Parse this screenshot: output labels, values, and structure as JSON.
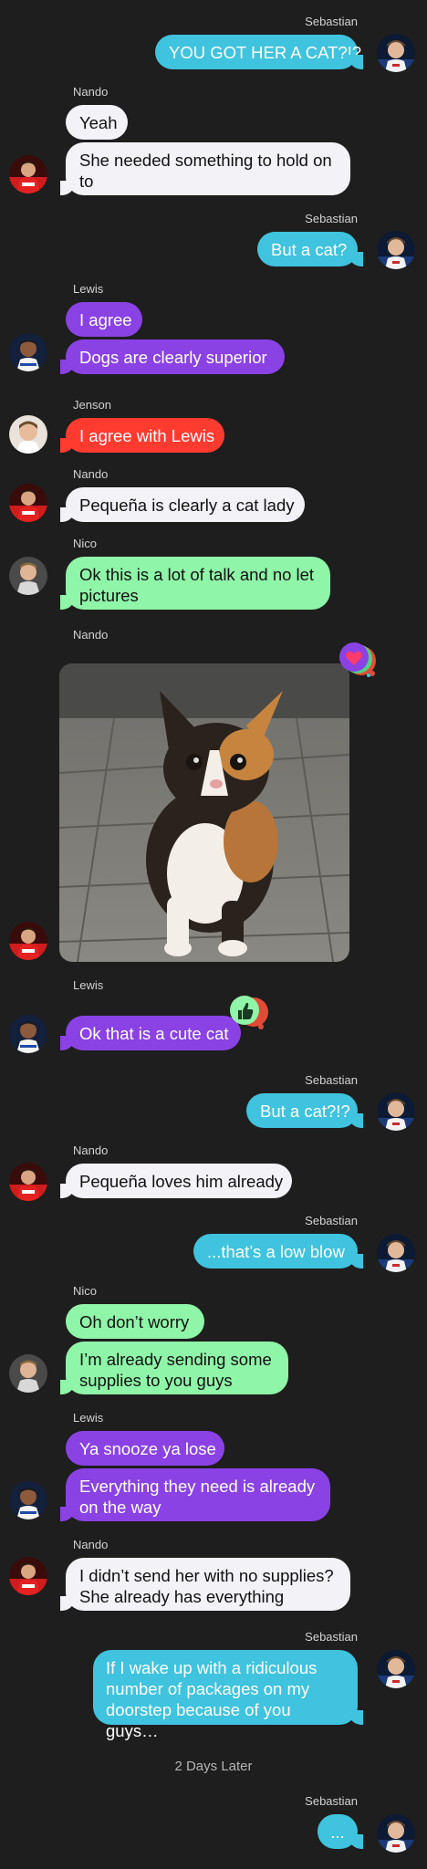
{
  "colors": {
    "background": "#1e1e1e",
    "blue": "#3fc3de",
    "purple": "#8a42e4",
    "red": "#ff3b30",
    "green": "#8ff5a8",
    "white": "#f2f2f7"
  },
  "messages": [
    {
      "sender": "Sebastian",
      "text": "YOU GOT HER A CAT?!?"
    },
    {
      "sender": "Nando",
      "text": "Yeah"
    },
    {
      "sender": "Nando",
      "text": "She needed something to hold on to"
    },
    {
      "sender": "Sebastian",
      "text": "But a cat?"
    },
    {
      "sender": "Lewis",
      "text": "I agree"
    },
    {
      "sender": "Lewis",
      "text": "Dogs are clearly superior"
    },
    {
      "sender": "Jenson",
      "text": "I agree with Lewis"
    },
    {
      "sender": "Nando",
      "text": "Pequeña is clearly a cat lady"
    },
    {
      "sender": "Nico",
      "text": "Ok this is a lot of talk and no let pictures"
    },
    {
      "sender": "Nando",
      "attachment": "kitten-photo",
      "reaction": "heart-icon"
    },
    {
      "sender": "Lewis",
      "text": "Ok that is a cute cat",
      "reaction": "thumbs-up-icon"
    },
    {
      "sender": "Sebastian",
      "text": "But a cat?!?"
    },
    {
      "sender": "Nando",
      "text": "Pequeña loves him already"
    },
    {
      "sender": "Sebastian",
      "text": "...that’s a low blow"
    },
    {
      "sender": "Nico",
      "text": "Oh don’t worry"
    },
    {
      "sender": "Nico",
      "text": "I’m already sending some supplies to you guys"
    },
    {
      "sender": "Lewis",
      "text": "Ya snooze ya lose"
    },
    {
      "sender": "Lewis",
      "text": "Everything they need is already on the way"
    },
    {
      "sender": "Nando",
      "text": "I didn’t send her with no supplies? She already has everything"
    },
    {
      "sender": "Sebastian",
      "text": "If I wake up with a ridiculous number of packages on my doorstep because of you guys…"
    },
    {
      "sender": "Sebastian",
      "text": "..."
    }
  ],
  "divider": {
    "text": "2 Days Later"
  }
}
